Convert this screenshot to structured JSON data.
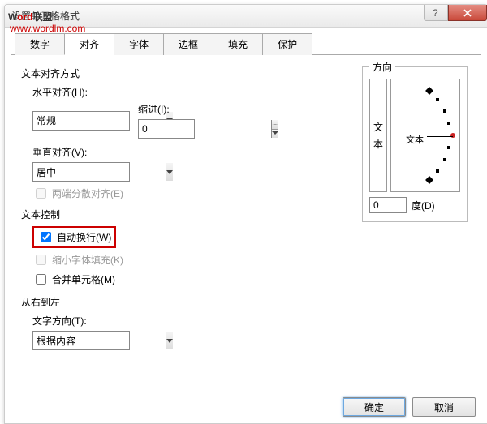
{
  "window": {
    "title": "设置单元格格式"
  },
  "watermark": {
    "text1": "W",
    "text2": "ord",
    "text3": "联盟",
    "url": "www.wordlm.com"
  },
  "tabs": [
    "数字",
    "对齐",
    "字体",
    "边框",
    "填充",
    "保护"
  ],
  "active_tab_index": 1,
  "align": {
    "section": "文本对齐方式",
    "horizontal_label": "水平对齐(H):",
    "horizontal_value": "常规",
    "indent_label": "缩进(I):",
    "indent_value": "0",
    "vertical_label": "垂直对齐(V):",
    "vertical_value": "居中",
    "justify_label": "两端分散对齐(E)"
  },
  "textctrl": {
    "section": "文本控制",
    "wrap_label": "自动换行(W)",
    "wrap_checked": true,
    "shrink_label": "缩小字体填充(K)",
    "merge_label": "合并单元格(M)"
  },
  "rtl": {
    "section": "从右到左",
    "dir_label": "文字方向(T):",
    "dir_value": "根据内容"
  },
  "direction": {
    "legend": "方向",
    "vert_text": "文本",
    "dial_text": "文本",
    "deg_value": "0",
    "deg_label": "度(D)"
  },
  "buttons": {
    "ok": "确定",
    "cancel": "取消"
  }
}
